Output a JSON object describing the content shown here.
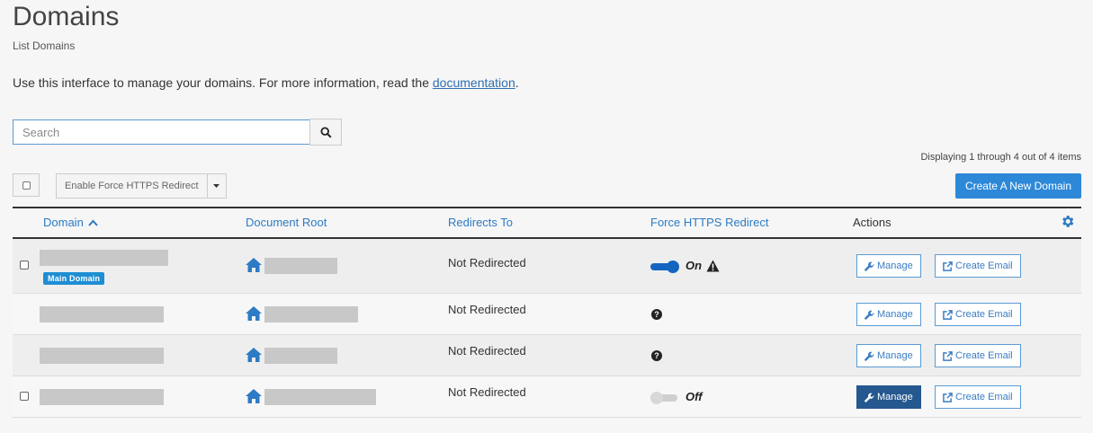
{
  "header": {
    "title": "Domains",
    "subtitle": "List Domains",
    "intro_text": "Use this interface to manage your domains. For more information, read the ",
    "intro_link": "documentation",
    "intro_end": "."
  },
  "search": {
    "placeholder": "Search"
  },
  "pagination": {
    "displaying": "Displaying 1 through 4 out of 4 items"
  },
  "toolbar": {
    "bulk_action_label": "Enable Force HTTPS Redirect",
    "create_label": "Create A New Domain"
  },
  "table": {
    "columns": {
      "domain": "Domain",
      "document_root": "Document Root",
      "redirects_to": "Redirects To",
      "force_https": "Force HTTPS Redirect",
      "actions": "Actions"
    },
    "rows": [
      {
        "redirects_to": "Not Redirected",
        "badge": "Main Domain",
        "https_status": "On",
        "manage": "Manage",
        "create_email": "Create Email"
      },
      {
        "redirects_to": "Not Redirected",
        "manage": "Manage",
        "create_email": "Create Email"
      },
      {
        "redirects_to": "Not Redirected",
        "manage": "Manage",
        "create_email": "Create Email"
      },
      {
        "redirects_to": "Not Redirected",
        "https_status": "Off",
        "manage": "Manage",
        "create_email": "Create Email"
      }
    ]
  },
  "colors": {
    "accent": "#2d89d8",
    "link": "#2d7bc4",
    "toggle_on": "#1465c0",
    "manage_active": "#24588f"
  }
}
